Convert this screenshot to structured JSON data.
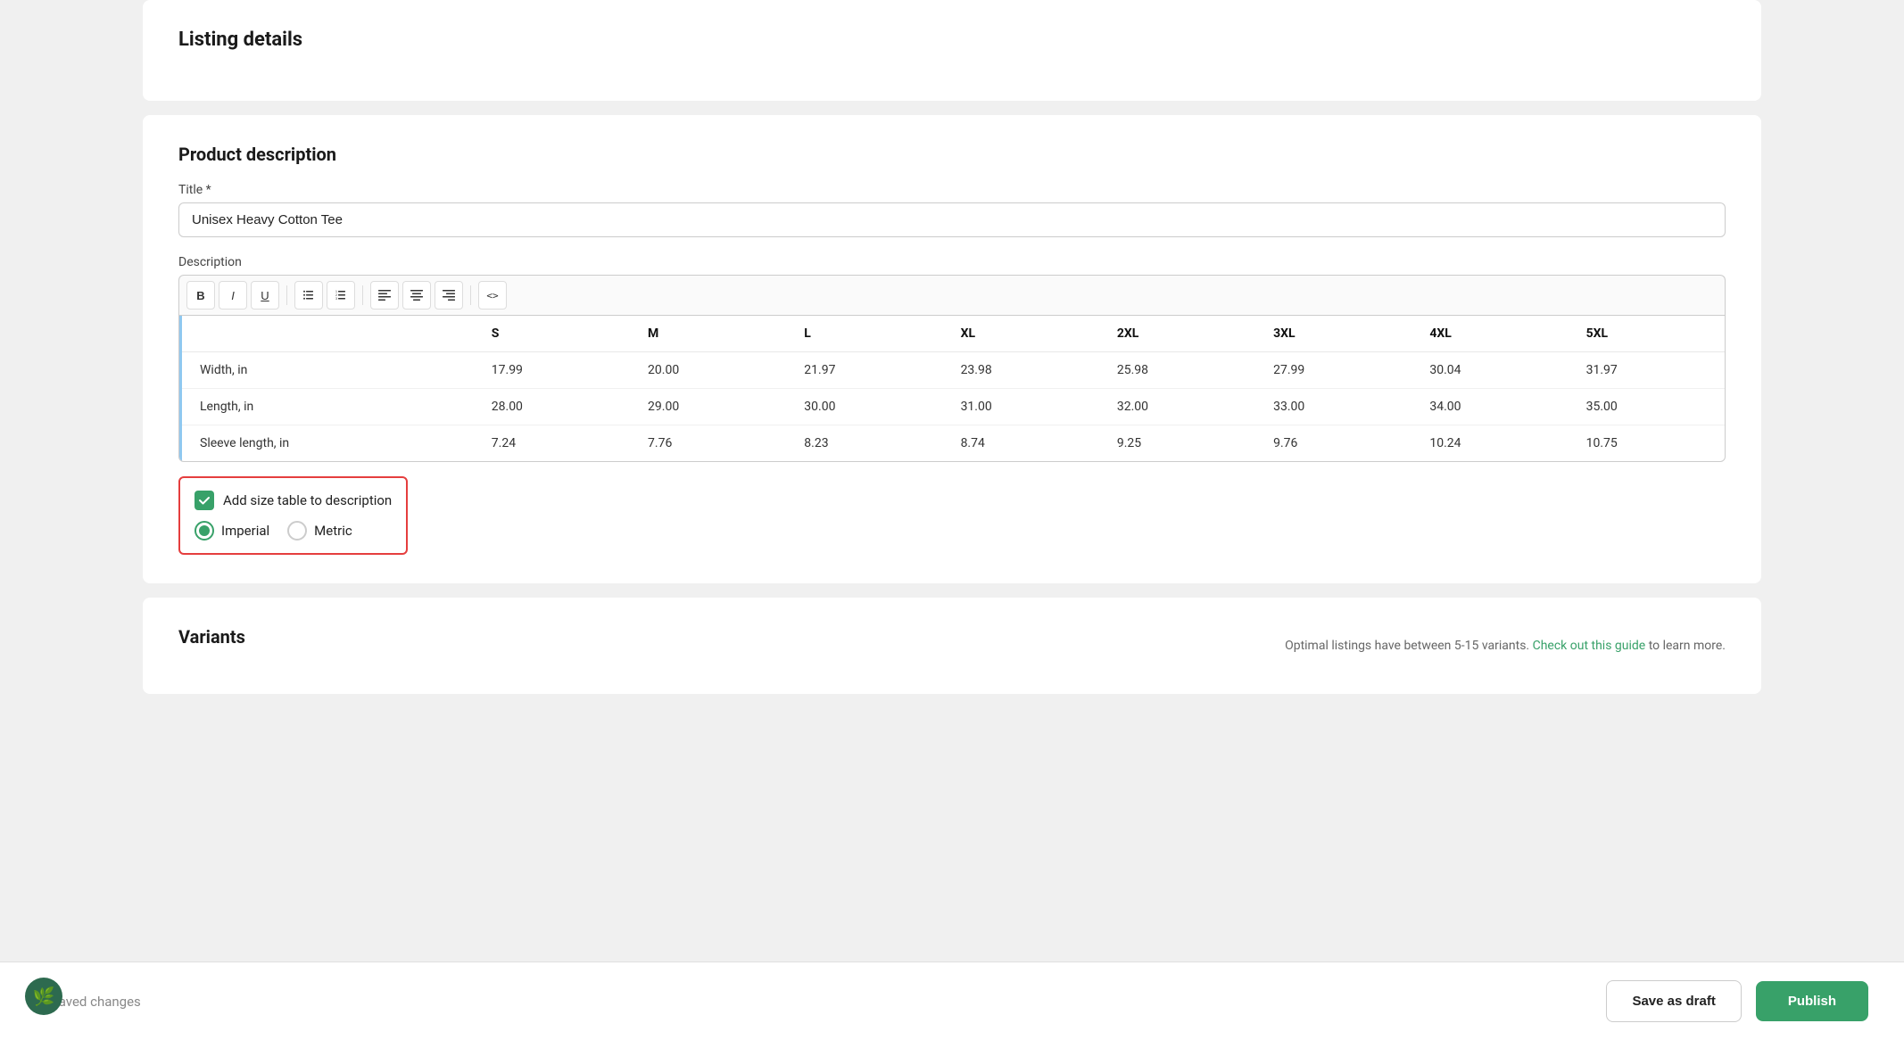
{
  "page": {
    "section_title": "Listing details",
    "product_description_title": "Product description",
    "title_label": "Title *",
    "title_value": "Unisex Heavy Cotton Tee",
    "description_label": "Description",
    "toolbar": {
      "bold": "B",
      "italic": "I",
      "underline": "U",
      "unordered_list": "ul",
      "ordered_list": "ol",
      "align_left": "al",
      "align_center": "ac",
      "align_right": "ar",
      "code": "<>"
    },
    "size_table": {
      "headers": [
        "",
        "S",
        "M",
        "L",
        "XL",
        "2XL",
        "3XL",
        "4XL",
        "5XL"
      ],
      "rows": [
        {
          "label": "Width, in",
          "values": [
            "17.99",
            "20.00",
            "21.97",
            "23.98",
            "25.98",
            "27.99",
            "30.04",
            "31.97"
          ]
        },
        {
          "label": "Length, in",
          "values": [
            "28.00",
            "29.00",
            "30.00",
            "31.00",
            "32.00",
            "33.00",
            "34.00",
            "35.00"
          ]
        },
        {
          "label": "Sleeve length, in",
          "values": [
            "7.24",
            "7.76",
            "8.23",
            "8.74",
            "9.25",
            "9.76",
            "10.24",
            "10.75"
          ]
        }
      ]
    },
    "add_size_table_label": "Add size table to description",
    "imperial_label": "Imperial",
    "metric_label": "Metric",
    "variants_title": "Variants",
    "variants_hint": "Optimal listings have between 5-15 variants.",
    "variants_link": "Check out this guide",
    "variants_hint_end": "to learn more.",
    "unsaved_label": "Unsaved changes",
    "save_draft_label": "Save as draft",
    "publish_label": "Publish"
  }
}
